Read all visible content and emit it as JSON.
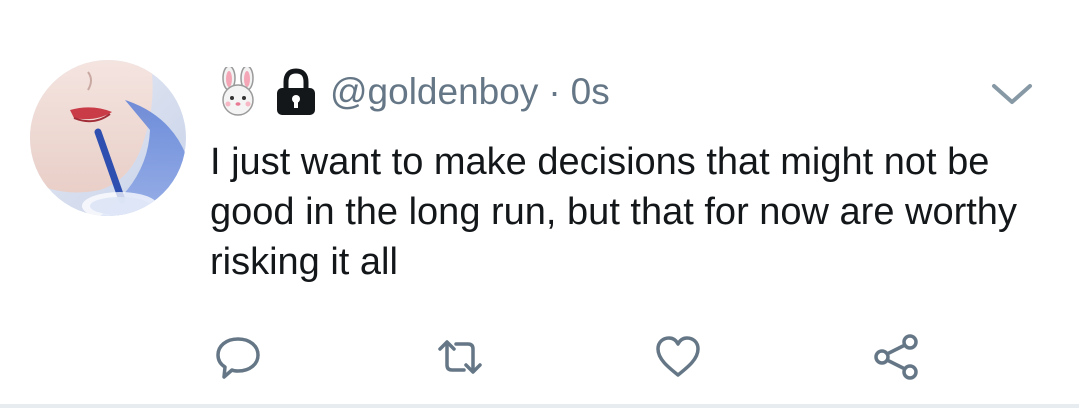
{
  "tweet": {
    "handle": "@goldenboy",
    "separator": "·",
    "timestamp": "0s",
    "text": "I just want to make decisions that might not be good in the long run, but that for now are worthy risking it all",
    "icons": {
      "profile_emoji": "rabbit-face-icon",
      "protected": "lock-icon",
      "menu": "chevron-down-icon"
    }
  },
  "actions": {
    "reply": "reply-icon",
    "retweet": "retweet-icon",
    "like": "heart-icon",
    "share": "share-icon"
  },
  "colors": {
    "secondary_text": "#657786",
    "primary_text": "#14171a",
    "icon": "#657786",
    "divider": "#e6ecf0"
  }
}
